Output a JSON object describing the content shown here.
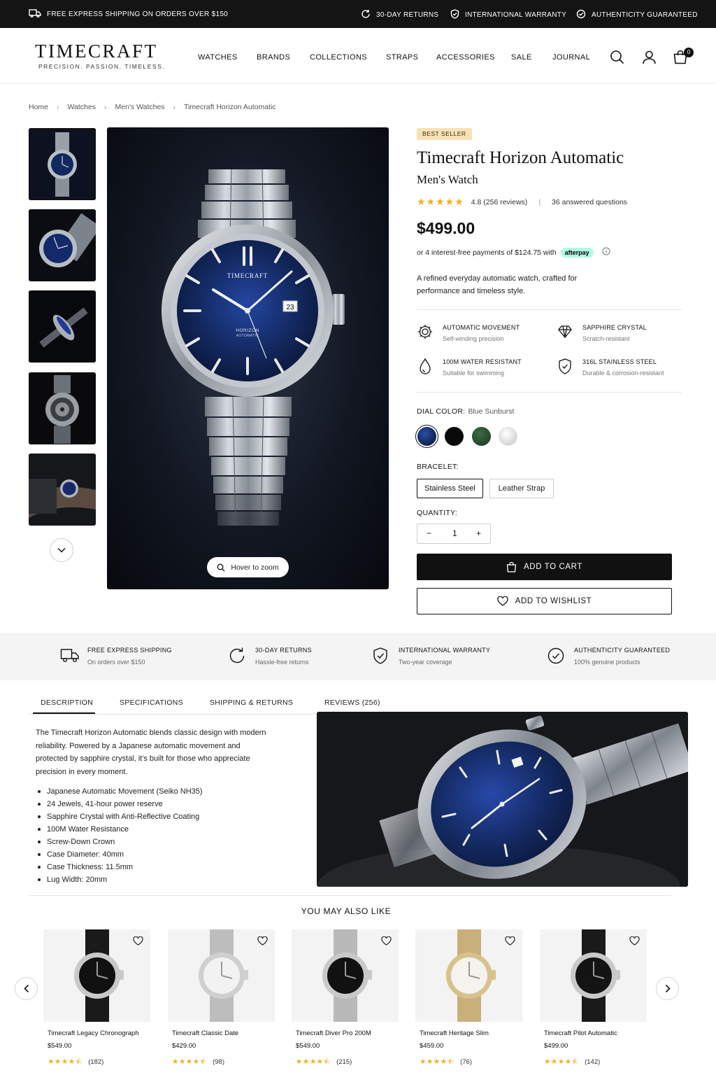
{
  "topbar": {
    "shipping": "FREE EXPRESS SHIPPING ON ORDERS OVER $150",
    "returns": "30-DAY RETURNS",
    "warranty": "INTERNATIONAL WARRANTY",
    "authenticity": "AUTHENTICITY GUARANTEED"
  },
  "brand": {
    "name": "TIMECRAFT",
    "tagline": "PRECISION. PASSION. TIMELESS."
  },
  "nav": [
    "WATCHES",
    "BRANDS",
    "COLLECTIONS",
    "STRAPS",
    "ACCESSORIES",
    "SALE",
    "JOURNAL"
  ],
  "cart_count": "0",
  "breadcrumb": [
    "Home",
    "Watches",
    "Men's Watches",
    "Timecraft Horizon Automatic"
  ],
  "gallery": {
    "zoom_label": "Hover to zoom",
    "watch_brand": "TIMECRAFT",
    "watch_model_1": "HORIZON",
    "watch_model_2": "AUTOMATIC",
    "date": "23"
  },
  "product": {
    "badge": "BEST SELLER",
    "title": "Timecraft Horizon Automatic",
    "subtitle": "Men's Watch",
    "rating": 4.8,
    "rating_text": "4.8 (256 reviews)",
    "questions": "36 answered questions",
    "price": "$499.00",
    "installments": "or 4 interest-free payments of $124.75 with",
    "afterpay": "afterpay",
    "short_description": "A refined everyday automatic watch, crafted for performance and timeless style.",
    "features": [
      {
        "icon": "gear-icon",
        "title": "AUTOMATIC MOVEMENT",
        "sub": "Self-winding precision"
      },
      {
        "icon": "diamond-icon",
        "title": "SAPPHIRE CRYSTAL",
        "sub": "Scratch-resistant"
      },
      {
        "icon": "water-drop-icon",
        "title": "100M WATER RESISTANT",
        "sub": "Suitable for swimming"
      },
      {
        "icon": "shield-check-icon",
        "title": "316L STAINLESS STEEL",
        "sub": "Durable & corrosion-resistant"
      }
    ],
    "dial_label": "DIAL COLOR:",
    "dial_value": "Blue Sunburst",
    "dial_colors": [
      "#13285e",
      "#0a0a0a",
      "#24452a",
      "#e4e4e4"
    ],
    "bracelet_label": "BRACELET:",
    "bracelet_options": [
      "Stainless Steel",
      "Leather Strap"
    ],
    "quantity_label": "QUANTITY:",
    "quantity": "1",
    "qty_minus": "−",
    "qty_plus": "+",
    "add_to_cart": "ADD TO CART",
    "add_to_wishlist": "ADD TO WISHLIST"
  },
  "trust": [
    {
      "icon": "truck-icon",
      "title": "FREE EXPRESS SHIPPING",
      "sub": "On orders over $150"
    },
    {
      "icon": "returns-icon",
      "title": "30-DAY RETURNS",
      "sub": "Hassle-free returns"
    },
    {
      "icon": "shield-check-icon",
      "title": "INTERNATIONAL WARRANTY",
      "sub": "Two-year coverage"
    },
    {
      "icon": "badge-check-icon",
      "title": "AUTHENTICITY GUARANTEED",
      "sub": "100% genuine products"
    }
  ],
  "tabs": [
    "DESCRIPTION",
    "SPECIFICATIONS",
    "SHIPPING & RETURNS",
    "REVIEWS (256)"
  ],
  "description": "The Timecraft Horizon Automatic blends classic design with modern reliability. Powered by a Japanese automatic movement and protected by sapphire crystal, it's built for those who appreciate precision in every moment.",
  "specs": [
    "Japanese Automatic Movement (Seiko NH35)",
    "24 Jewels, 41-hour power reserve",
    "Sapphire Crystal with Anti-Reflective Coating",
    "100M Water Resistance",
    "Screw-Down Crown",
    "Case Diameter: 40mm",
    "Case Thickness: 11.5mm",
    "Lug Width: 20mm"
  ],
  "related": {
    "title": "YOU MAY ALSO LIKE",
    "items": [
      {
        "name": "Timecraft Legacy Chronograph",
        "price": "$549.00",
        "reviews": "(182)",
        "stars": "★★★★⯪",
        "dial": "#111111",
        "band": "#1a1a1a",
        "case": "#c9c9c9"
      },
      {
        "name": "Timecraft Classic Date",
        "price": "$429.00",
        "reviews": "(98)",
        "stars": "★★★★⯪",
        "dial": "#f2f2f2",
        "band": "#bdbdbd",
        "case": "#cfcfcf"
      },
      {
        "name": "Timecraft Diver Pro 200M",
        "price": "$549.00",
        "reviews": "(215)",
        "stars": "★★★★⯪",
        "dial": "#111111",
        "band": "#b9b9b9",
        "case": "#c9c9c9"
      },
      {
        "name": "Timecraft Heritage Slim",
        "price": "$459.00",
        "reviews": "(76)",
        "stars": "★★★★⯪",
        "dial": "#f5f3ee",
        "band": "#c8b07a",
        "case": "#d7c28e"
      },
      {
        "name": "Timecraft Pilot Automatic",
        "price": "$499.00",
        "reviews": "(142)",
        "stars": "★★★★⯪",
        "dial": "#141414",
        "band": "#1a1a1a",
        "case": "#c9c9c9"
      }
    ]
  }
}
